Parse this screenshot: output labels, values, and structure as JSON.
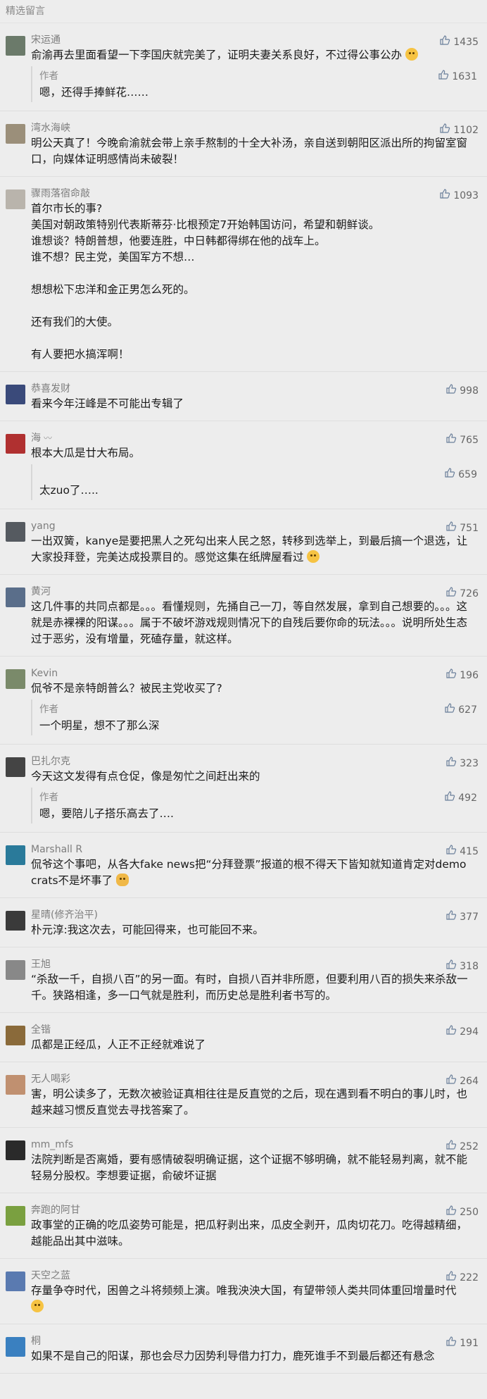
{
  "header": {
    "title": "精选留言"
  },
  "comments": [
    {
      "nick": "宋运通",
      "likes": "1435",
      "text": "俞渝再去里面看望一下李国庆就完美了，证明夫妻关系良好，不过得公事公办",
      "reply": {
        "author": "作者",
        "likes": "1631",
        "text": "嗯，还得手捧鲜花……"
      }
    },
    {
      "nick": "湾水海峡",
      "likes": "1102",
      "text": "明公天真了！今晚俞渝就会带上亲手熬制的十全大补汤，亲自送到朝阳区派出所的拘留室窗口，向媒体证明感情尚未破裂！"
    },
    {
      "nick": "骤雨落宿命敲",
      "likes": "1093",
      "text": "首尔市长的事?\n美国对朝政策特别代表斯蒂芬·比根预定7开始韩国访问，希望和朝鲜谈。\n谁想谈？特朗普想，他要连胜，中日韩都得绑在他的战车上。\n谁不想？民主党，美国军方不想…\n\n想想松下忠洋和金正男怎么死的。\n\n还有我们的大使。\n\n有人要把水搞浑啊！"
    },
    {
      "nick": "恭喜发财",
      "likes": "998",
      "text": "看来今年汪峰是不可能出专辑了"
    },
    {
      "nick": "海",
      "badge": "〰",
      "likes": "765",
      "text": "根本大瓜是廿大布局。",
      "reply": {
        "author": "",
        "likes": "659",
        "text": "太zuo了….."
      }
    },
    {
      "nick": "yang",
      "likes": "751",
      "text": "一出双簧，kanye是要把黑人之死勾出来人民之怒，转移到选举上，到最后搞一个退选，让大家投拜登，完美达成投票目的。感觉这集在纸牌屋看过"
    },
    {
      "nick": "黄河",
      "likes": "726",
      "text": "这几件事的共同点都是。。。看懂规则，先捅自己一刀，等自然发展，拿到自己想要的。。。这就是赤裸裸的阳谋。。。属于不破坏游戏规则情况下的自残后要你命的玩法。。。说明所处生态过于恶劣，没有增量，死磕存量，就这样。"
    },
    {
      "nick": "Kevin",
      "likes": "196",
      "text": "侃爷不是亲特朗普么？被民主党收买了?",
      "reply": {
        "author": "作者",
        "likes": "627",
        "text": "一个明星，想不了那么深"
      }
    },
    {
      "nick": "巴扎尔克",
      "likes": "323",
      "text": "今天这文发得有点仓促，像是匆忙之间赶出来的",
      "reply": {
        "author": "作者",
        "likes": "492",
        "text": "嗯，要陪儿子搭乐高去了…."
      }
    },
    {
      "nick": "Marshall R",
      "likes": "415",
      "text": "侃爷这个事吧，从各大fake news把“分拜登票”报道的根不得天下皆知就知道肯定对democrats不是坏事了"
    },
    {
      "nick": "星晴(修齐治平)",
      "likes": "377",
      "text": "朴元淳:我这次去，可能回得来，也可能回不来。"
    },
    {
      "nick": "王旭",
      "likes": "318",
      "text": "“杀敌一千，自损八百”的另一面。有时，自损八百并非所愿，但要利用八百的损失来杀敌一千。狭路相逢，多一口气就是胜利，而历史总是胜利者书写的。"
    },
    {
      "nick": "全锴",
      "likes": "294",
      "text": "瓜都是正经瓜，人正不正经就难说了"
    },
    {
      "nick": "无人喝彩",
      "likes": "264",
      "text": "害，明公读多了，无数次被验证真相往往是反直觉的之后，现在遇到看不明白的事儿时，也越来越习惯反直觉去寻找答案了。"
    },
    {
      "nick": "mm_mfs",
      "likes": "252",
      "text": "法院判断是否离婚，要有感情破裂明确证据，这个证据不够明确，就不能轻易判离，就不能轻易分股权。李想要证据，俞破坏证据"
    },
    {
      "nick": "奔跑的阿甘",
      "likes": "250",
      "text": "政事堂的正确的吃瓜姿势可能是，把瓜籽剥出来，瓜皮全剥开，瓜肉切花刀。吃得越精细，越能品出其中滋味。"
    },
    {
      "nick": "天空之蓝",
      "likes": "222",
      "text": "存量争夺时代，困兽之斗将频频上演。唯我泱泱大国，有望带领人类共同体重回增量时代"
    },
    {
      "nick": "桐",
      "likes": "191",
      "text": "如果不是自己的阳谋，那也会尽力因势利导借力打力，鹿死谁手不到最后都还有悬念"
    }
  ],
  "avatars": [
    "#6b7a6a",
    "#9b8f7a",
    "#b9b4ac",
    "#3a4a7a",
    "#b03030",
    "#555a60",
    "#5a6e8a",
    "#7a8a6a",
    "#444444",
    "#2a7a9a",
    "#3a3a3a",
    "#888888",
    "#8a6a3a",
    "#c09070",
    "#2a2a2a",
    "#7aa040",
    "#5a7ab0",
    "#3a80c0"
  ]
}
